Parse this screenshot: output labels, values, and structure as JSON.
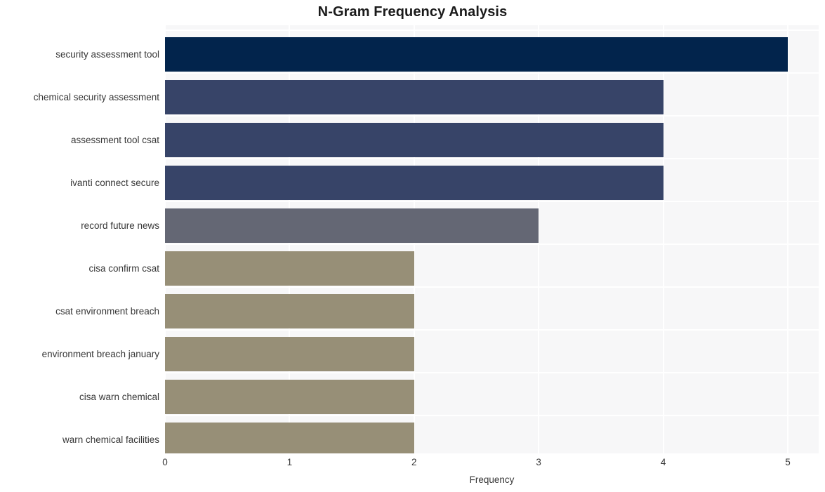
{
  "chart_data": {
    "type": "bar",
    "orientation": "horizontal",
    "title": "N-Gram Frequency Analysis",
    "xlabel": "Frequency",
    "ylabel": "",
    "xlim": [
      0,
      5.25
    ],
    "xticks": [
      "0",
      "1",
      "2",
      "3",
      "4",
      "5"
    ],
    "xtick_values": [
      0,
      1,
      2,
      3,
      4,
      5
    ],
    "grid": true,
    "grid_color": "#ffffff",
    "plot_background": "#f7f7f8",
    "legend": null,
    "categories": [
      "security assessment tool",
      "chemical security assessment",
      "assessment tool csat",
      "ivanti connect secure",
      "record future news",
      "cisa confirm csat",
      "csat environment breach",
      "environment breach january",
      "cisa warn chemical",
      "warn chemical facilities"
    ],
    "values": [
      5,
      4,
      4,
      4,
      3,
      2,
      2,
      2,
      2,
      2
    ],
    "bar_colors": [
      "#02244c",
      "#374468",
      "#374468",
      "#374468",
      "#646774",
      "#978f77",
      "#978f77",
      "#978f77",
      "#978f77",
      "#978f77"
    ]
  },
  "text_colors": {
    "title": "#1a1a1a",
    "tick": "#373737",
    "axis_title": "#373737"
  }
}
